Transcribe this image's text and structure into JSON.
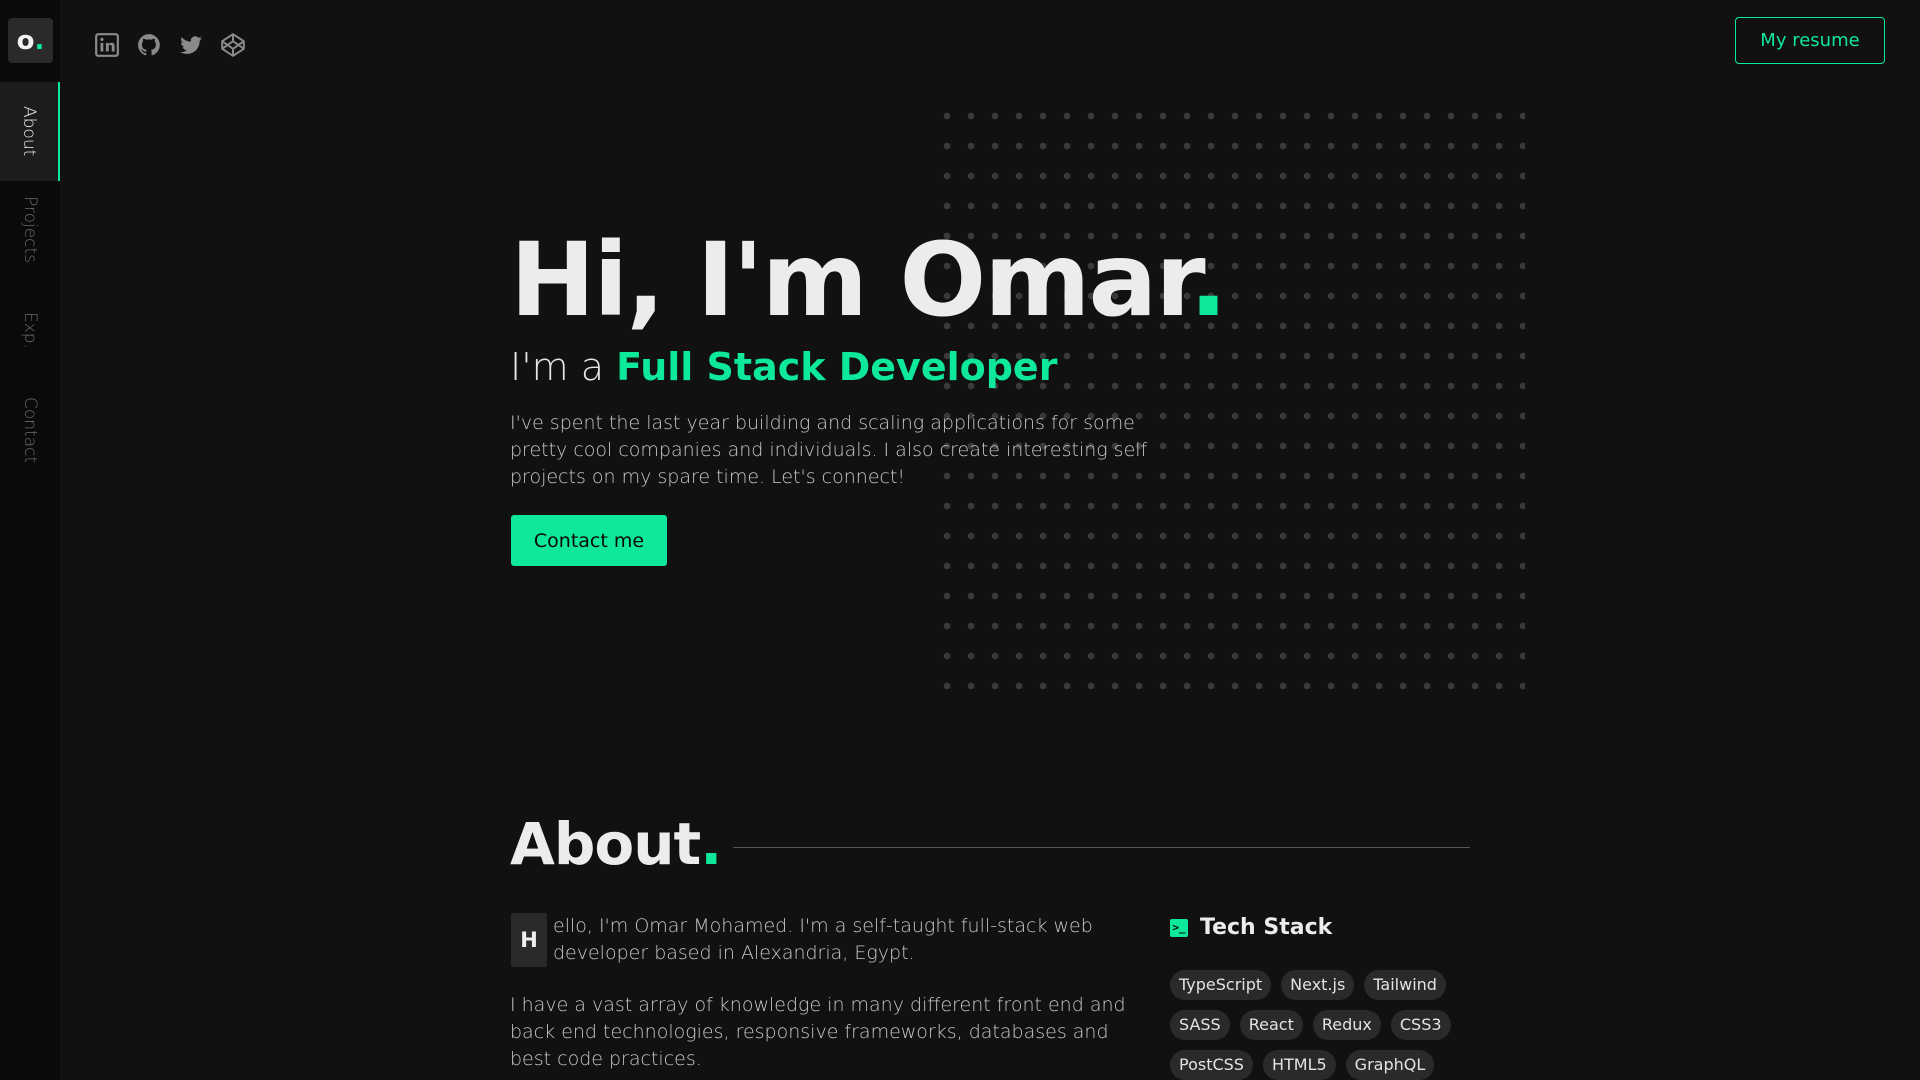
{
  "logo": {
    "letter": "o",
    "dot": "."
  },
  "nav": {
    "items": [
      {
        "label": "About",
        "active": true
      },
      {
        "label": "Projects",
        "active": false
      },
      {
        "label": "Exp.",
        "active": false
      },
      {
        "label": "Contact",
        "active": false
      }
    ]
  },
  "social": {
    "icons": [
      "linkedin-icon",
      "github-icon",
      "twitter-icon",
      "codepen-icon"
    ]
  },
  "header": {
    "resume_label": "My resume"
  },
  "hero": {
    "title": "Hi, I'm Omar",
    "title_dot": ".",
    "subtitle_prefix": "I'm a",
    "subtitle_accent": "Full Stack Developer",
    "description": "I've spent the last year building and scaling applications for some pretty cool companies and individuals. I also create interesting self projects on my spare time. Let's connect!",
    "contact_label": "Contact me"
  },
  "about": {
    "title": "About",
    "title_dot": ".",
    "dropcap": "H",
    "p1": "ello, I'm Omar Mohamed. I'm a self-taught full-stack web developer based in Alexandria, Egypt.",
    "p2": "I have a vast array of knowledge in many different front end and back end technologies, responsive frameworks, databases and best code practices."
  },
  "tech_stack": {
    "icon": ">_",
    "title": "Tech Stack",
    "items": [
      "TypeScript",
      "Next.js",
      "Tailwind",
      "SASS",
      "React",
      "Redux",
      "CSS3",
      "PostCSS",
      "HTML5",
      "GraphQL"
    ]
  },
  "colors": {
    "background": "#111111",
    "sidebar": "#0a0a0a",
    "accent": "#0ee89a",
    "chip": "#2a2a2a"
  }
}
